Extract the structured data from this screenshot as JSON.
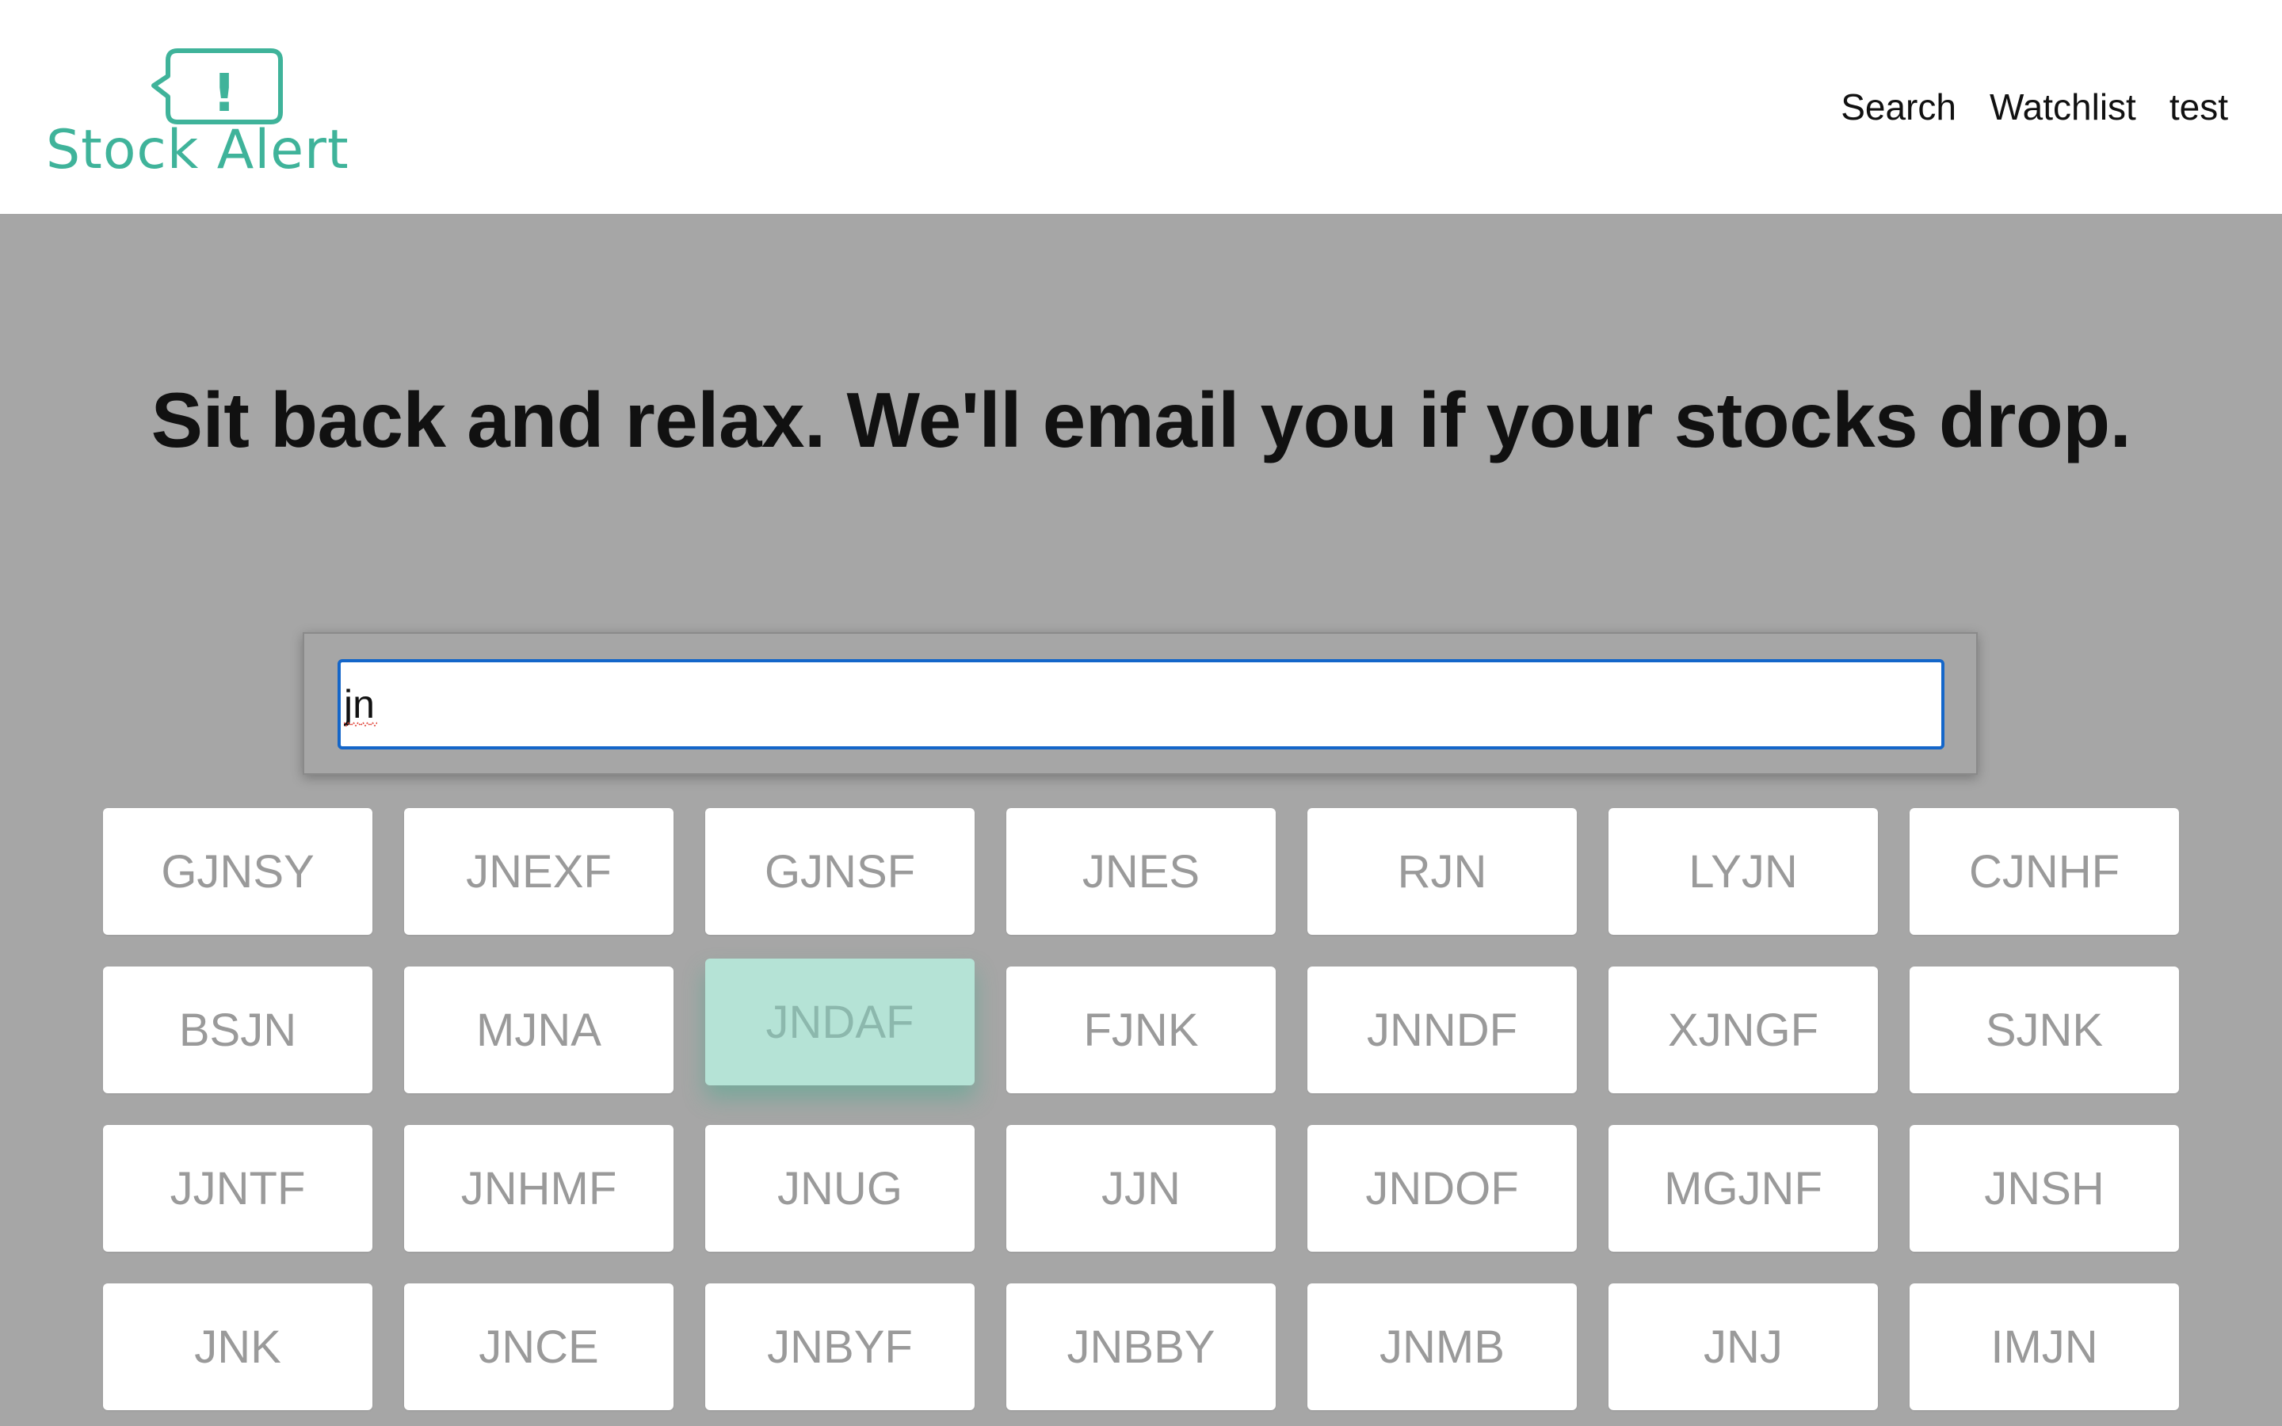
{
  "brand": {
    "name": "Stock Alert",
    "icon_mark": "!",
    "color": "#3fb39a"
  },
  "nav": {
    "search": "Search",
    "watchlist": "Watchlist",
    "user": "test"
  },
  "hero": {
    "headline": "Sit back and relax. We'll email you if your stocks drop."
  },
  "search": {
    "value": "jn",
    "focus_color": "#1466c9"
  },
  "results": {
    "active_index": 9,
    "active_color": "#b5e3d6",
    "symbols": [
      "GJNSY",
      "JNEXF",
      "GJNSF",
      "JNES",
      "RJN",
      "LYJN",
      "CJNHF",
      "BSJN",
      "MJNA",
      "JNDAF",
      "FJNK",
      "JNNDF",
      "XJNGF",
      "SJNK",
      "JJNTF",
      "JNHMF",
      "JNUG",
      "JJN",
      "JNDOF",
      "MGJNF",
      "JNSH",
      "JNK",
      "JNCE",
      "JNBYF",
      "JNBBY",
      "JNMB",
      "JNJ",
      "IMJN"
    ]
  }
}
